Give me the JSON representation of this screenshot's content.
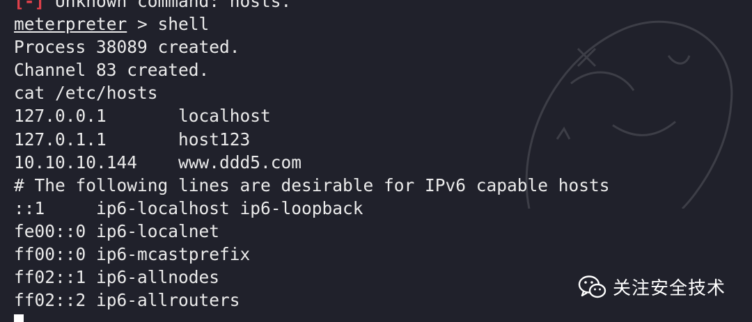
{
  "terminal": {
    "lines": [
      {
        "type": "error",
        "tag": "[-]",
        "text": " Unknown command: hosts."
      },
      {
        "type": "prompt",
        "prompt": "meterpreter",
        "text": " > shell"
      },
      {
        "type": "output",
        "text": "Process 38089 created."
      },
      {
        "type": "output",
        "text": "Channel 83 created."
      },
      {
        "type": "command",
        "text": "cat /etc/hosts"
      },
      {
        "type": "output",
        "text": "127.0.0.1       localhost"
      },
      {
        "type": "output",
        "text": "127.0.1.1       host123"
      },
      {
        "type": "output",
        "text": "10.10.10.144    www.ddd5.com"
      },
      {
        "type": "output",
        "text": "# The following lines are desirable for IPv6 capable hosts"
      },
      {
        "type": "output",
        "text": "::1     ip6-localhost ip6-loopback"
      },
      {
        "type": "output",
        "text": "fe00::0 ip6-localnet"
      },
      {
        "type": "output",
        "text": "ff00::0 ip6-mcastprefix"
      },
      {
        "type": "output",
        "text": "ff02::1 ip6-allnodes"
      },
      {
        "type": "output",
        "text": "ff02::2 ip6-allrouters"
      }
    ]
  },
  "watermark": {
    "icon": "wechat-icon",
    "text": "关注安全技术"
  },
  "colors": {
    "background": "#20212b",
    "text": "#ebebeb",
    "error": "#e0404a"
  }
}
